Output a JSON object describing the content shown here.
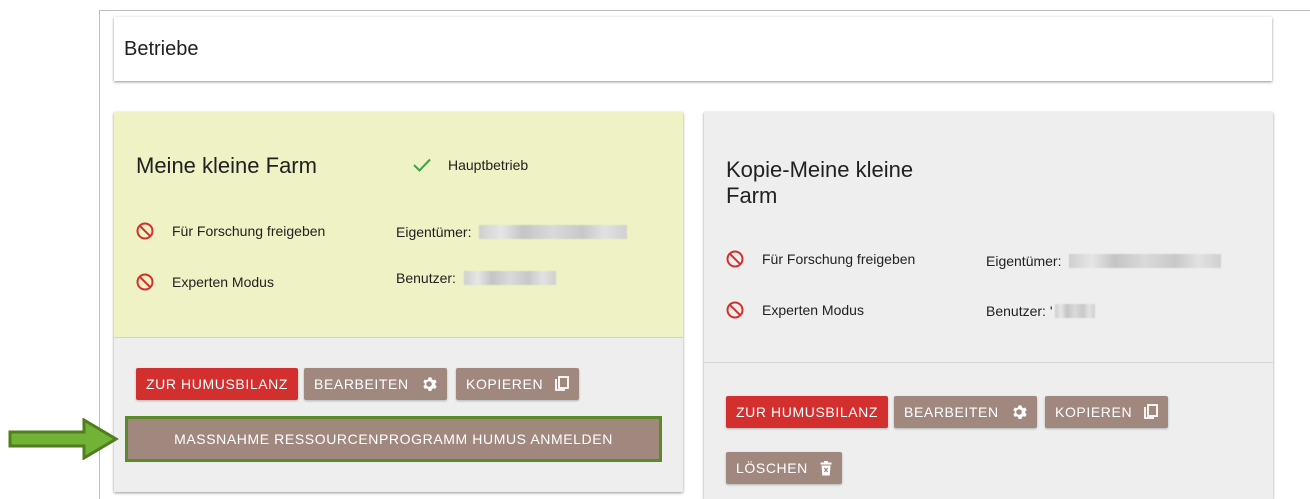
{
  "header": {
    "title": "Betriebe"
  },
  "farms": [
    {
      "title": "Meine kleine Farm",
      "main_flag": "Hauptbetrieb",
      "research_label": "Für Forschung freigeben",
      "expert_label": "Experten Modus",
      "owner_label": "Eigentümer:",
      "user_label": "Benutzer:",
      "btn_humus": "ZUR HUMUSBILANZ",
      "btn_edit": "BEARBEITEN",
      "btn_copy": "KOPIEREN",
      "btn_register": "MASSNAHME RESSOURCENPROGRAMM HUMUS ANMELDEN"
    },
    {
      "title": "Kopie-Meine kleine Farm",
      "research_label": "Für Forschung freigeben",
      "expert_label": "Experten Modus",
      "owner_label": "Eigentümer:",
      "user_label": "Benutzer: '",
      "btn_humus": "ZUR HUMUSBILANZ",
      "btn_edit": "BEARBEITEN",
      "btn_copy": "KOPIEREN",
      "btn_delete": "LÖSCHEN"
    }
  ],
  "colors": {
    "primary_red": "#d32f2f",
    "secondary_brown": "#a1887f",
    "main_farm_bg": "#eef2c4",
    "highlight_green": "#5a8a2a",
    "ban_red": "#d32f2f",
    "check_green": "#43a047"
  },
  "icons": [
    "check-icon",
    "ban-icon",
    "gear-icon",
    "copy-icon",
    "trash-icon",
    "arrow-right-icon"
  ]
}
